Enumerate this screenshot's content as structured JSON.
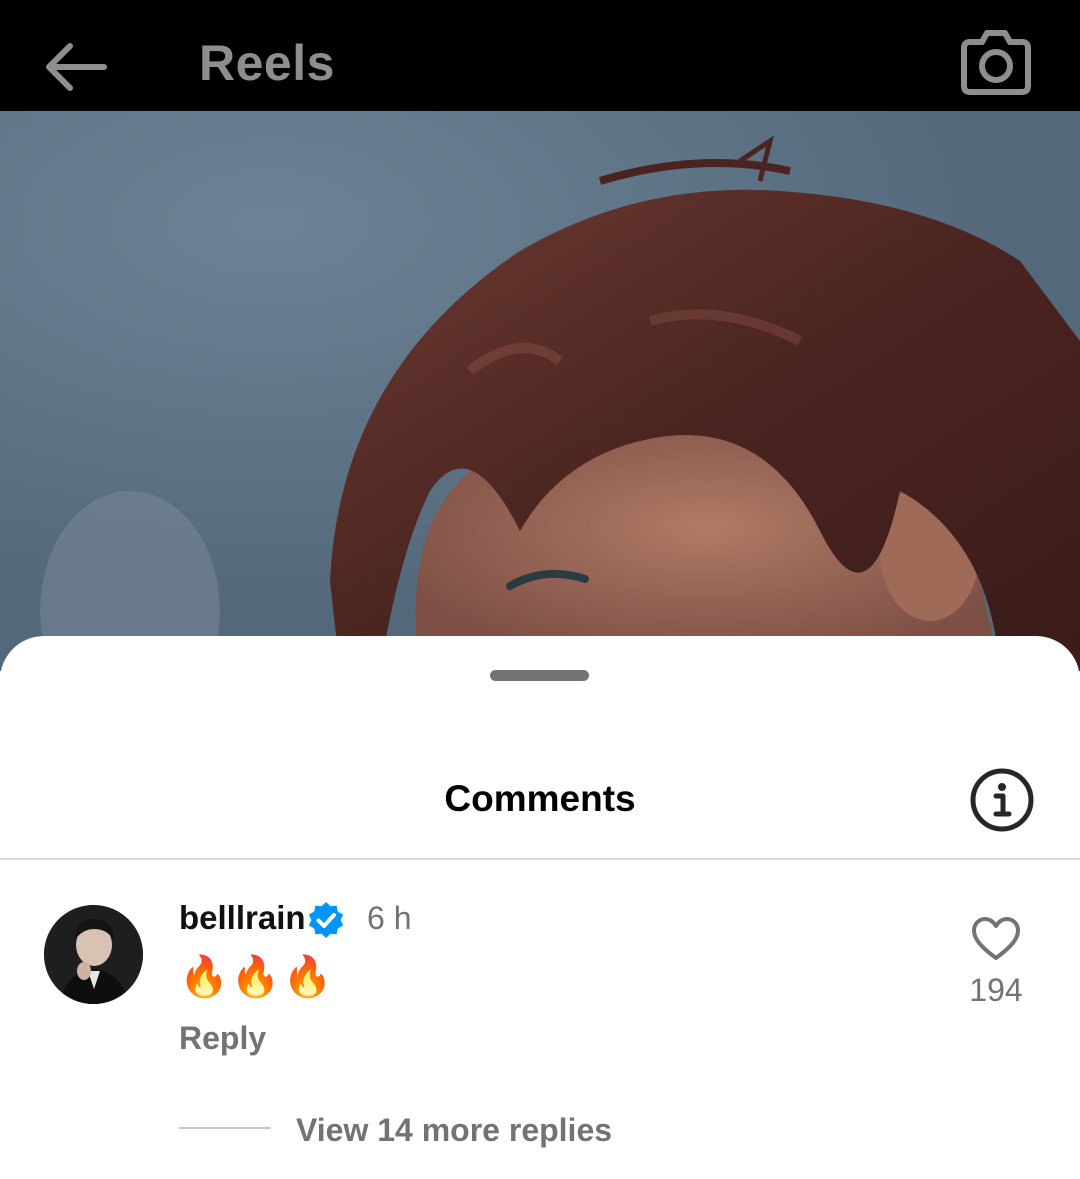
{
  "header": {
    "title": "Reels",
    "back_icon": "arrow-left-icon",
    "camera_icon": "camera-icon",
    "background": "#000000",
    "title_color": "#8e8e8e"
  },
  "comments_sheet": {
    "title": "Comments",
    "info_icon": "info-icon"
  },
  "comment": {
    "username": "belllrain",
    "verified": true,
    "verified_color": "#0095f6",
    "time": "6 h",
    "text": "🔥🔥🔥",
    "reply_label": "Reply",
    "like_icon": "heart-outline-icon",
    "like_count": "194",
    "view_replies_label": "View 14 more replies"
  }
}
